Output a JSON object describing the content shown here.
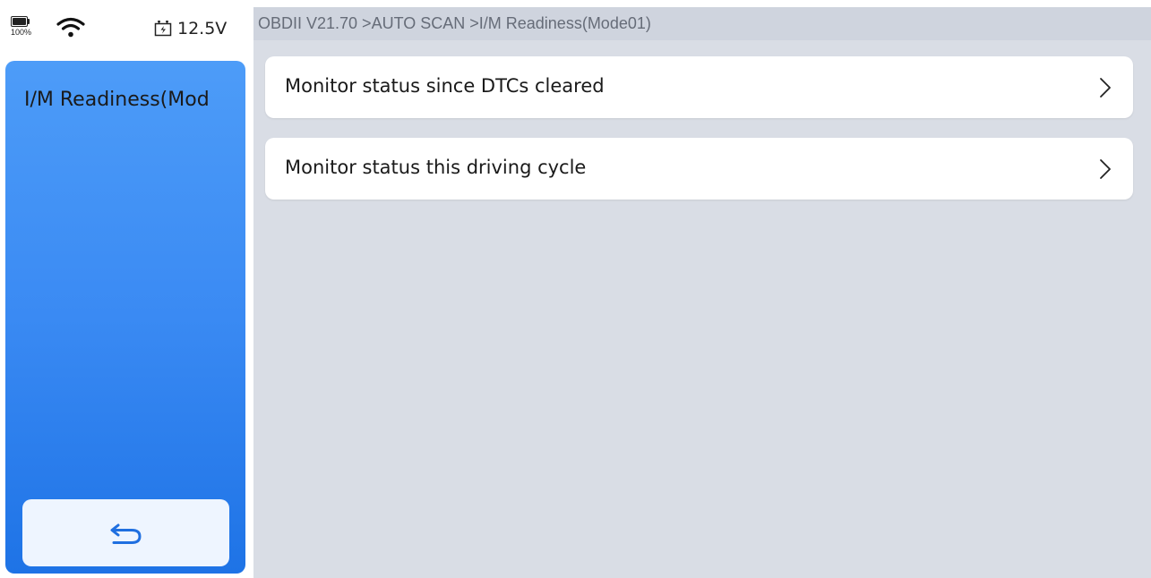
{
  "status": {
    "battery_percent": "100%",
    "battery_level": 1.0,
    "wifi_icon": "wifi-icon",
    "voltage": "12.5V",
    "voltage_icon": "car-battery-icon"
  },
  "sidebar": {
    "title": "I/M Readiness(Mod",
    "back_icon": "return-arrow-icon"
  },
  "header": {
    "breadcrumb": "OBDII V21.70 >AUTO SCAN >I/M Readiness(Mode01)"
  },
  "menu": {
    "items": [
      {
        "label": "Monitor status since DTCs cleared",
        "icon": "chevron-right-icon"
      },
      {
        "label": "Monitor status this driving cycle",
        "icon": "chevron-right-icon"
      }
    ]
  },
  "colors": {
    "sidebar_gradient_top": "#4d9cf8",
    "sidebar_gradient_bottom": "#1e73e6",
    "main_background": "#d9dde5",
    "card_background": "#ffffff",
    "back_button_background": "#eef5ff"
  }
}
